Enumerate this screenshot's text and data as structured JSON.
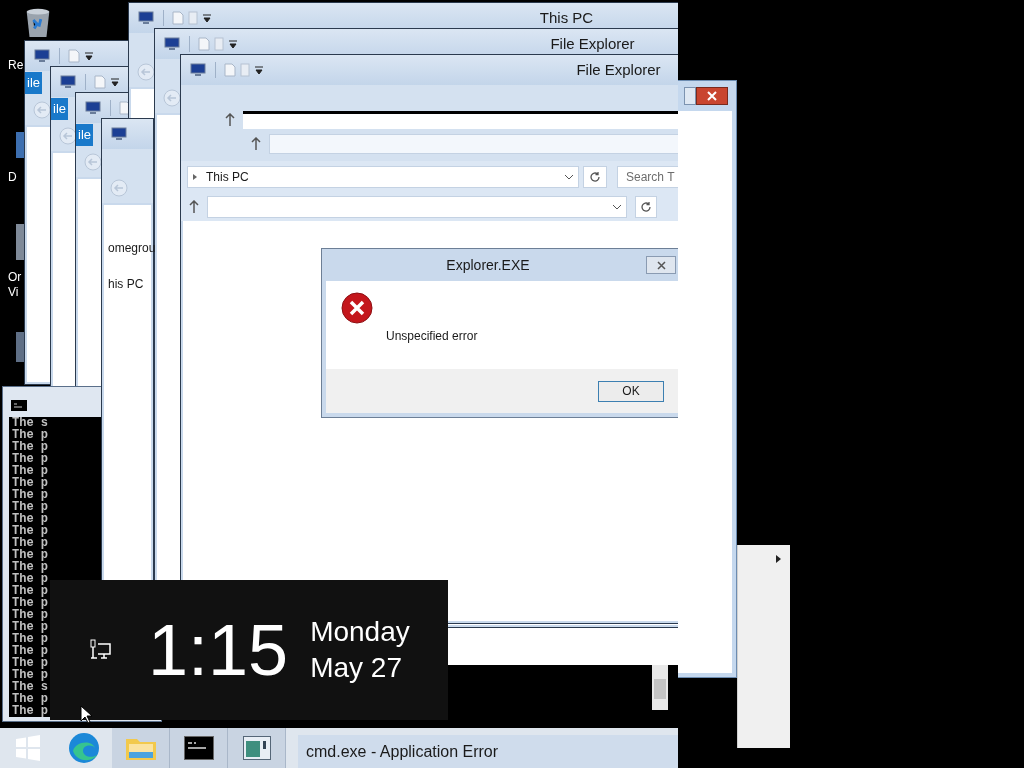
{
  "desktop": {
    "icons": [
      {
        "lines": [
          "Re"
        ]
      },
      {
        "lines": [
          "D"
        ]
      },
      {
        "lines": [
          "Or",
          "Vi"
        ]
      }
    ]
  },
  "explorer_windows": [
    {
      "ribbon_tab": "ile"
    },
    {
      "ribbon_tab": "ile"
    },
    {
      "ribbon_tab": "ile"
    },
    {
      "title": "This PC"
    },
    {
      "title": "File Explorer"
    },
    {
      "nav_items": [
        "omegrou",
        "his PC"
      ]
    },
    {
      "title": "File Explorer",
      "address": "This PC",
      "search_placeholder": "Search T"
    }
  ],
  "console": {
    "lines": [
      "The s",
      "The p",
      "The p",
      "The p",
      "The p",
      "The p",
      "The p",
      "The p",
      "The p",
      "The p",
      "The p",
      "The p",
      "The p",
      "The p",
      "The p",
      "The p",
      "The p",
      "The p",
      "The p",
      "The p",
      "The p",
      "The p",
      "The s",
      "The p",
      "The p"
    ]
  },
  "error_dialog": {
    "title": "Explorer.EXE",
    "message": "Unspecified error",
    "buttons": [
      "OK"
    ]
  },
  "clock": {
    "time": "1:15",
    "day": "Monday",
    "date": "May 27"
  },
  "taskbar": {
    "items": [
      {
        "kind": "start"
      },
      {
        "kind": "browser"
      },
      {
        "kind": "folder"
      },
      {
        "kind": "console"
      },
      {
        "kind": "app"
      }
    ],
    "window_title": "cmd.exe - Application Error"
  }
}
